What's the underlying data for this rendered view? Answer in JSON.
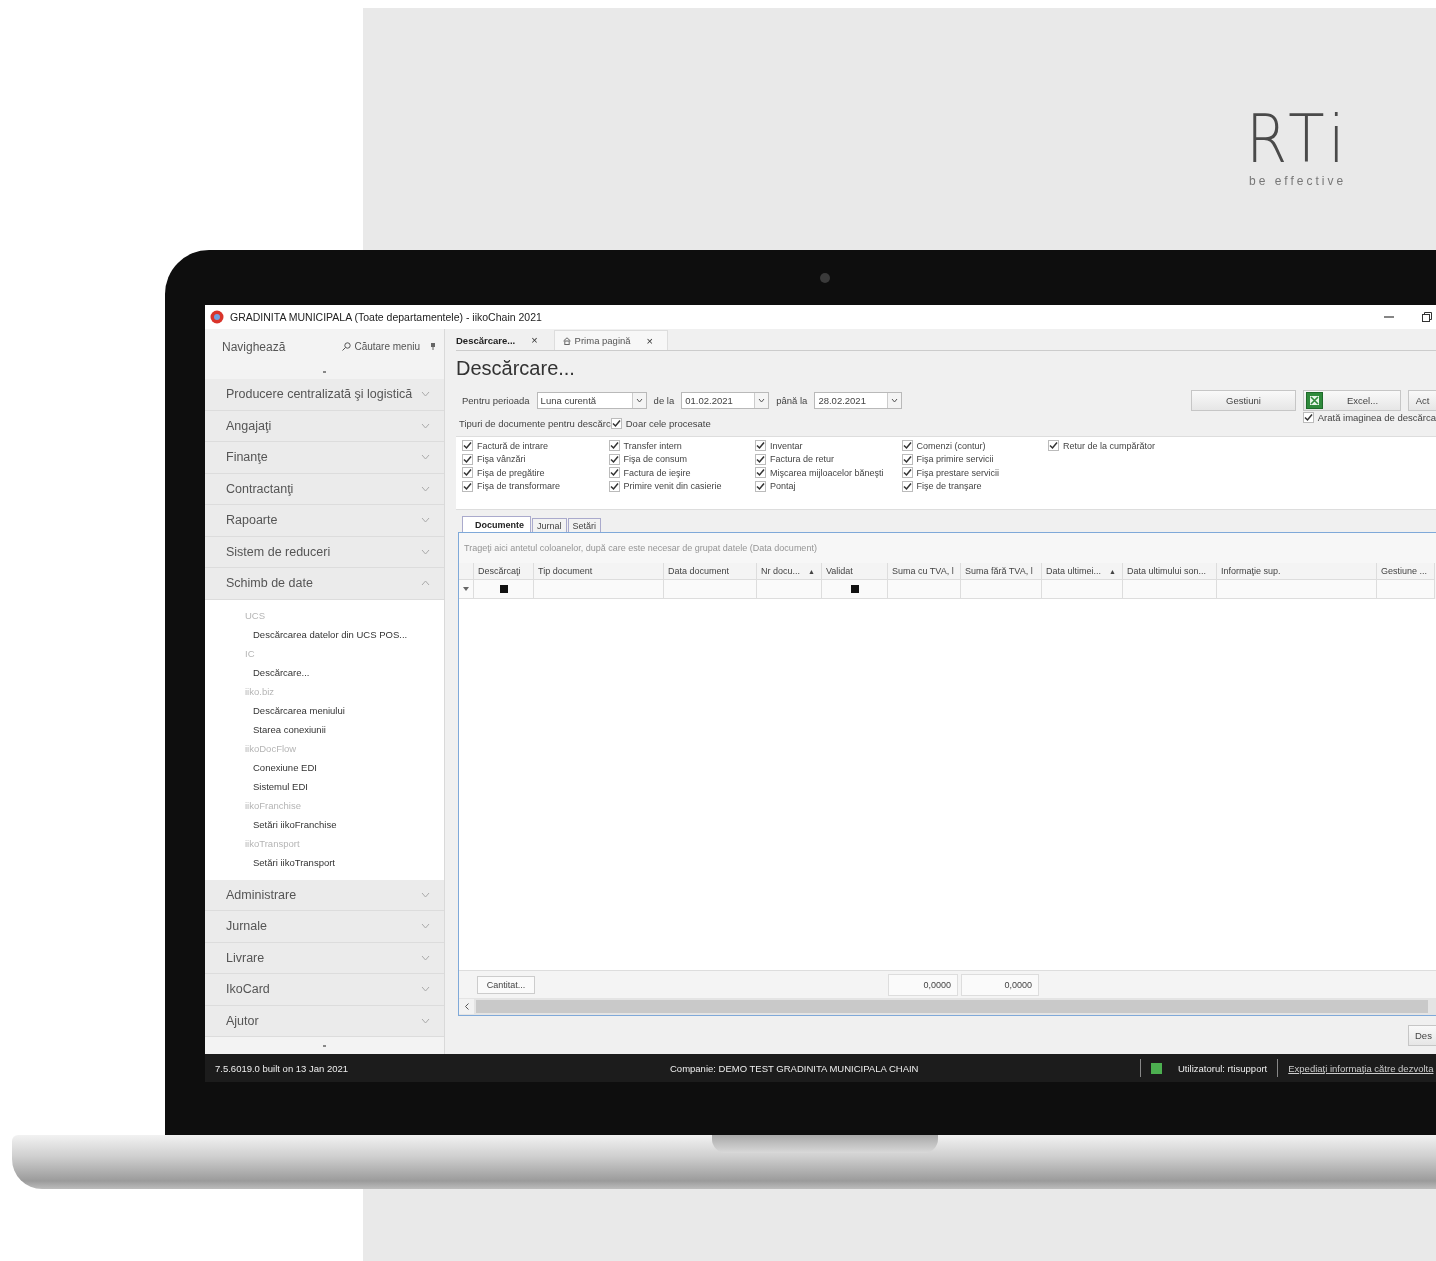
{
  "logo": {
    "name": "RTi",
    "tagline": "be effective"
  },
  "window": {
    "title": "GRADINITA MUNICIPALA (Toate departamentele) - iikoChain 2021"
  },
  "sidebar": {
    "title": "Navighează",
    "search_label": "Căutare meniu",
    "groups": [
      {
        "label": "Producere centralizată şi logistică",
        "expanded": false
      },
      {
        "label": "Angajaţi",
        "expanded": false
      },
      {
        "label": "Finanţe",
        "expanded": false
      },
      {
        "label": "Contractanţi",
        "expanded": false
      },
      {
        "label": "Rapoarte",
        "expanded": false
      },
      {
        "label": "Sistem de reduceri",
        "expanded": false
      },
      {
        "label": "Schimb de date",
        "expanded": true,
        "children": [
          {
            "label": "UCS",
            "children": [
              {
                "label": "Descărcarea datelor din UCS POS..."
              }
            ]
          },
          {
            "label": "IC",
            "children": [
              {
                "label": "Descărcare..."
              }
            ]
          },
          {
            "label": "iiko.biz",
            "children": [
              {
                "label": "Descărcarea meniului"
              },
              {
                "label": "Starea conexiunii"
              }
            ]
          },
          {
            "label": "iikoDocFlow",
            "children": [
              {
                "label": "Conexiune EDI"
              },
              {
                "label": "Sistemul EDI"
              }
            ]
          },
          {
            "label": "iikoFranchise",
            "children": [
              {
                "label": "Setări iikoFranchise"
              }
            ]
          },
          {
            "label": "iikoTransport",
            "children": [
              {
                "label": "Setări iikoTransport"
              }
            ]
          }
        ]
      },
      {
        "label": "Administrare",
        "expanded": false
      },
      {
        "label": "Jurnale",
        "expanded": false
      },
      {
        "label": "Livrare",
        "expanded": false
      },
      {
        "label": "IkoCard",
        "expanded": false
      },
      {
        "label": "Ajutor",
        "expanded": false
      }
    ]
  },
  "tabs": [
    {
      "label": "Descărcare...",
      "kind": "page",
      "selected": true,
      "close": "×"
    },
    {
      "label": "Prima pagină",
      "kind": "home",
      "selected": false,
      "close": "×"
    }
  ],
  "heading": "Descărcare...",
  "period": {
    "label": "Pentru perioada",
    "value": "Luna curentă",
    "from_label": "de la",
    "from": "01.02.2021",
    "to_label": "până la",
    "to": "28.02.2021"
  },
  "buttons": [
    {
      "label": "Gestiuni",
      "kind": "plain"
    },
    {
      "label": "Excel...",
      "kind": "excel"
    },
    {
      "label": "Act",
      "kind": "plain"
    }
  ],
  "show_image": {
    "label": "Arată imaginea de descărca",
    "checked": true
  },
  "document_types_label": "Tipuri de documente pentru descărc",
  "only_processed": {
    "label": "Doar cele procesate",
    "checked": true
  },
  "document_types": [
    [
      {
        "label": "Factură de intrare",
        "checked": true
      },
      {
        "label": "Fişa vânzări",
        "checked": true
      },
      {
        "label": "Fişa de pregătire",
        "checked": true
      },
      {
        "label": "Fişa de transformare",
        "checked": true
      }
    ],
    [
      {
        "label": "Transfer intern",
        "checked": true
      },
      {
        "label": "Fişa de consum",
        "checked": true
      },
      {
        "label": "Factura de ieşire",
        "checked": true
      },
      {
        "label": "Primire venit din casierie",
        "checked": true
      }
    ],
    [
      {
        "label": "Inventar",
        "checked": true
      },
      {
        "label": "Factura de retur",
        "checked": true
      },
      {
        "label": "Mişcarea mijloacelor băneşti",
        "checked": true
      },
      {
        "label": "Pontaj",
        "checked": true
      }
    ],
    [
      {
        "label": "Comenzi (contur)",
        "checked": true
      },
      {
        "label": "Fişa primire servicii",
        "checked": true
      },
      {
        "label": "Fişa prestare servicii",
        "checked": true
      },
      {
        "label": "Fişe de tranşare",
        "checked": true
      }
    ],
    [
      {
        "label": "Retur de la cumpărător",
        "checked": true
      }
    ]
  ],
  "inner_tabs": [
    {
      "label": "Documente",
      "selected": true
    },
    {
      "label": "Jurnal",
      "selected": false
    },
    {
      "label": "Setări",
      "selected": false
    }
  ],
  "grid": {
    "group_hint": "Trageţi aici antetul coloanelor, după care este necesar de grupat datele (Data document)",
    "columns": [
      {
        "label": "Descărcaţi",
        "filter_checkbox": true
      },
      {
        "label": "Tip document",
        "filter_checkbox": false
      },
      {
        "label": "Data document",
        "filter_checkbox": false
      },
      {
        "label": "Nr docu...",
        "sort": "▲",
        "filter_checkbox": false
      },
      {
        "label": "Validat",
        "filter_checkbox": true
      },
      {
        "label": "Suma cu TVA, l",
        "filter_checkbox": false,
        "total": "0,0000"
      },
      {
        "label": "Suma fără TVA, l",
        "filter_checkbox": false,
        "total": "0,0000"
      },
      {
        "label": "Data ultimei...",
        "sort": "▲",
        "filter_checkbox": false
      },
      {
        "label": "Data ultimului son...",
        "filter_checkbox": false
      },
      {
        "label": "Informaţie sup.",
        "filter_checkbox": false
      },
      {
        "label": "Gestiune ...",
        "filter_checkbox": false
      }
    ],
    "footer_button": "Cantitat..."
  },
  "bottom_button": "Des",
  "status_bar": {
    "version": "7.5.6019.0 built on 13 Jan 2021",
    "company": "Companie: DEMO TEST GRADINITA MUNICIPALA CHAIN",
    "user": "Utilizatorul: rtisupport",
    "link": "Expediaţi informaţia către dezvolta"
  }
}
